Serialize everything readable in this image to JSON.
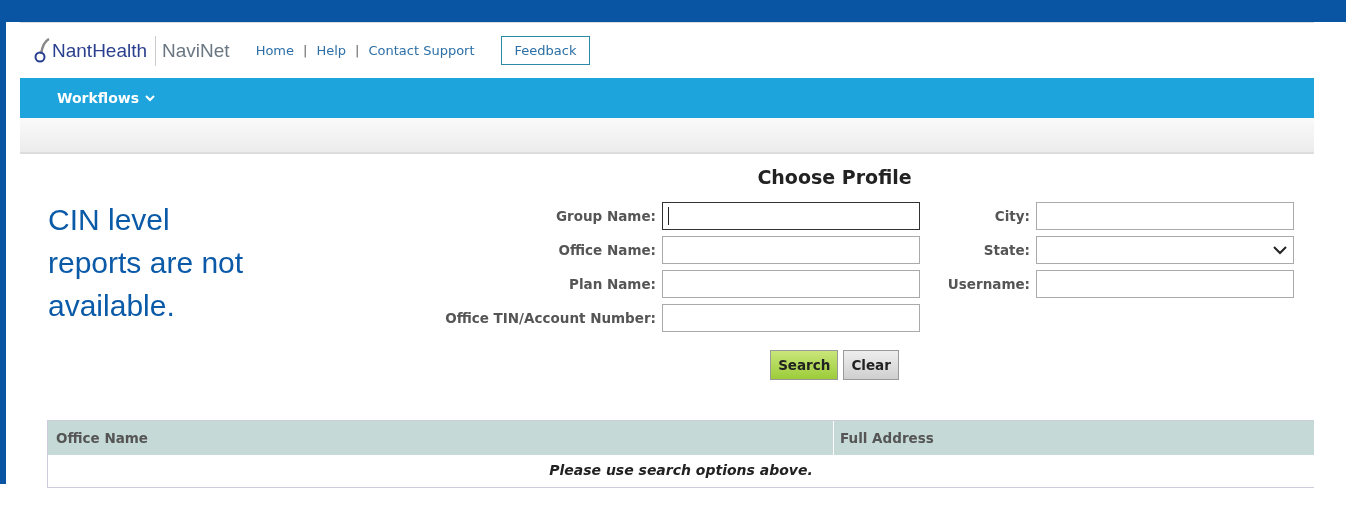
{
  "header": {
    "logo_brand": "NantHealth",
    "logo_product": "NaviNet",
    "links": [
      "Home",
      "Help",
      "Contact Support"
    ],
    "link_separator": "|",
    "feedback_button": "Feedback"
  },
  "nav": {
    "menu": "Workflows"
  },
  "notice": "CIN level reports are not available.",
  "form": {
    "title": "Choose Profile",
    "left_fields": [
      {
        "label": "Group Name:",
        "kind": "text",
        "focused": true
      },
      {
        "label": "Office Name:",
        "kind": "text",
        "focused": false
      },
      {
        "label": "Plan Name:",
        "kind": "text",
        "focused": false
      },
      {
        "label": "Office TIN/Account Number:",
        "kind": "text",
        "focused": false
      }
    ],
    "right_fields": [
      {
        "label": "City:",
        "kind": "text",
        "focused": false
      },
      {
        "label": "State:",
        "kind": "select",
        "focused": false
      },
      {
        "label": "Username:",
        "kind": "text",
        "focused": false
      }
    ],
    "buttons": [
      {
        "label": "Search",
        "kind": "primary"
      },
      {
        "label": "Clear",
        "kind": "secondary"
      }
    ]
  },
  "table": {
    "columns": [
      "Office Name",
      "Full Address"
    ],
    "empty_message": "Please use search options above."
  }
}
